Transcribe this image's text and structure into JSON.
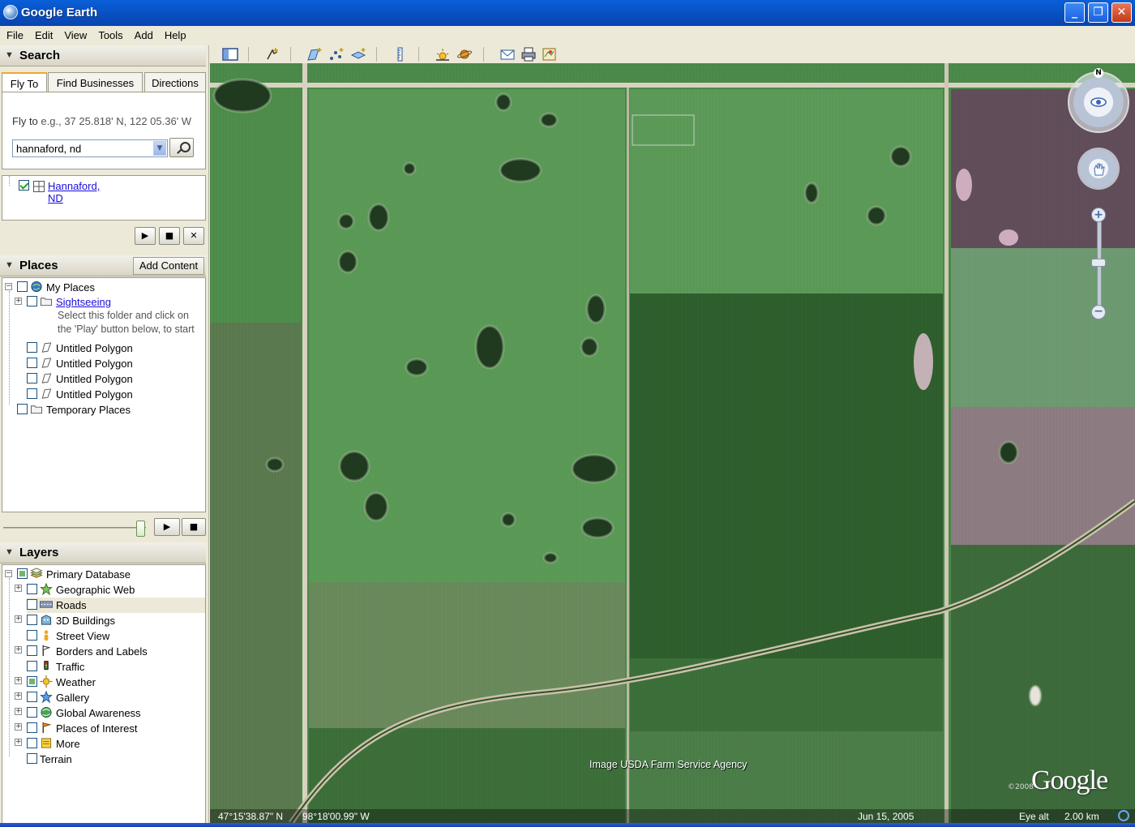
{
  "window": {
    "title": "Google Earth"
  },
  "menu": [
    "File",
    "Edit",
    "View",
    "Tools",
    "Add",
    "Help"
  ],
  "search": {
    "header": "Search",
    "tabs": [
      "Fly To",
      "Find Businesses",
      "Directions"
    ],
    "flyto_label": "Fly to",
    "flyto_hint": "e.g., 37 25.818' N, 122 05.36' W",
    "flyto_value": "hannaford, nd",
    "result": "Hannaford, ND"
  },
  "places": {
    "header": "Places",
    "add_content": "Add Content",
    "my_places": "My Places",
    "sightseeing": "Sightseeing",
    "sightseeing_desc_1": "Select this folder and click on",
    "sightseeing_desc_2": "the 'Play' button below, to start",
    "polygons": [
      "Untitled Polygon",
      "Untitled Polygon",
      "Untitled Polygon",
      "Untitled Polygon"
    ],
    "temporary": "Temporary Places"
  },
  "layers": {
    "header": "Layers",
    "primary": "Primary Database",
    "items": [
      "Geographic Web",
      "Roads",
      "3D Buildings",
      "Street View",
      "Borders and Labels",
      "Traffic",
      "Weather",
      "Gallery",
      "Global Awareness",
      "Places of Interest",
      "More"
    ],
    "terrain": "Terrain"
  },
  "map": {
    "credit": "Image USDA Farm Service Agency",
    "wordmark": "Google",
    "lat": "47°15'38.87\" N",
    "lon": "98°18'00.99\" W",
    "date": "Jun 15, 2005",
    "eye_alt_label": "Eye alt",
    "eye_alt_value": "2.00 km",
    "compass_n": "N",
    "copyright_year": "©2008"
  }
}
